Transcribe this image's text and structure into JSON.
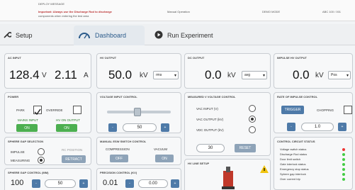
{
  "topbar": {
    "line1": "DEPLOY MESSAGE",
    "line2": "Important: Always use the Discharge Rod to discharge",
    "line3": "components when entering the test area",
    "line4": "Manual Operation",
    "line5": "DEMO MODE",
    "line6": "ABC 100 / 001"
  },
  "tabs": {
    "setup": "Setup",
    "dashboard": "Dashboard",
    "run": "Run Experiment"
  },
  "ac_input": {
    "label": "AC Input",
    "voltage": "128.4",
    "v_unit": "V",
    "current": "2.11",
    "a_unit": "A"
  },
  "hv_output": {
    "label": "HV Output",
    "value": "50.0",
    "unit": "kV",
    "mode": "rms"
  },
  "dc_output": {
    "label": "DC Output",
    "value": "0.0",
    "unit": "kV",
    "mode": "avg"
  },
  "impulse_output": {
    "label": "Impulse HV Output",
    "value": "0.0",
    "unit": "kV",
    "mode": "Pos"
  },
  "power": {
    "label": "Power",
    "park": "PARK",
    "override": "OVERRIDE",
    "mains_label": "MAINS INPUT",
    "mains_state": "ON",
    "hv_label": "HV ON OUTPUT",
    "hv_state": "ON"
  },
  "voltage_input": {
    "label": "Voltage Input Control",
    "value": "50",
    "minus": "-",
    "plus": "+"
  },
  "measured_v": {
    "label": "Measured V Voltage Control",
    "opt1": "VAC INPUT (V)",
    "opt2": "VAC OUTPUT (kV)",
    "opt3": "VDC OUTPUT (kV)",
    "value": "30",
    "button": "RESET"
  },
  "rate": {
    "label": "Rate of Impulse Control",
    "trigger": "TRIGGER",
    "chopping": "CHOPPING",
    "value": "1.0",
    "minus": "-",
    "plus": "+"
  },
  "sphere_gap": {
    "label": "Sphere Gap Selection",
    "impulse": "IMPULSE",
    "measuring": "MEASURING",
    "rc": "RC POSITION",
    "retract": "RETRACT"
  },
  "manual_esw": {
    "label": "Manual ESW Switch Control",
    "compression": "COMPRESSION",
    "vacuum": "VACUUM",
    "off": "OFF",
    "on": "ON"
  },
  "control_status": {
    "label": "Control Circuit Status",
    "items": [
      "Voltage switch status",
      "Discharge Rod status",
      "Door limit switch",
      "Gate interlock status",
      "Emergency stop status",
      "Sphere gap interlock",
      "Over current trip"
    ],
    "colors": [
      "#e33",
      "#4c4",
      "#4c4",
      "#4c4",
      "#4c4",
      "#4c4",
      "#4c4"
    ]
  },
  "sphere_gap_control": {
    "label": "Sphere Gap Control (mm)",
    "value": "100",
    "set": "50"
  },
  "precision": {
    "label": "Precision Control (kV)",
    "value": "0.01",
    "set": "0.00"
  },
  "hv_setup": {
    "label": "HV Line Setup"
  }
}
